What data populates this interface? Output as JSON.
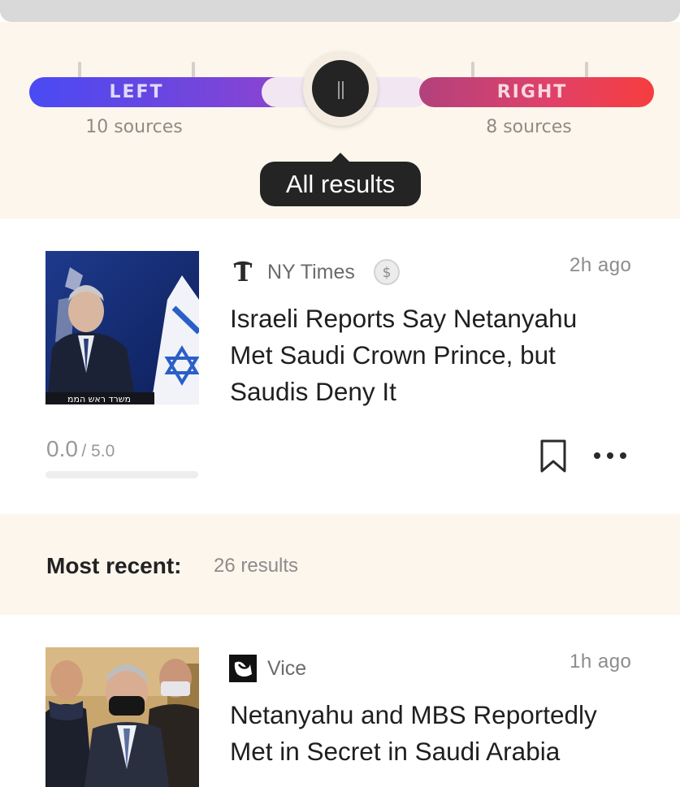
{
  "bias_filter": {
    "left_label": "LEFT",
    "left_count": "10 sources",
    "right_label": "RIGHT",
    "right_count": "8 sources",
    "tooltip": "All results",
    "colors": {
      "left_start": "#4a4af4",
      "left_end": "#8a44d0",
      "right_start": "#b2417c",
      "right_end": "#f63d3e",
      "knob": "#242424"
    }
  },
  "articles": [
    {
      "source": "NY Times",
      "source_icon": "nyt-logo-icon",
      "paywall_icon": "dollar-icon",
      "time": "2h ago",
      "headline_lines": [
        "Israeli Reports Say Netanyahu",
        "Met Saudi Crown Prince, but",
        "Saudis Deny It"
      ],
      "rating": {
        "value": "0.0",
        "max": "/ 5.0",
        "fill_fraction": 0.0
      },
      "actions": {
        "bookmark_icon": "bookmark-icon",
        "more_icon": "more-icon"
      }
    },
    {
      "source": "Vice",
      "source_icon": "vice-logo-icon",
      "time": "1h ago",
      "headline_lines": [
        "Netanyahu and MBS Reportedly",
        "Met in Secret in Saudi Arabia"
      ]
    }
  ],
  "most_recent": {
    "label": "Most recent:",
    "count": "26 results"
  },
  "background_color": "#fcf6ec"
}
